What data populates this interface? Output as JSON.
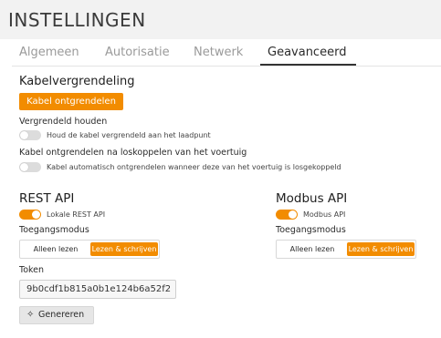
{
  "header": {
    "title": "INSTELLINGEN"
  },
  "tabs": [
    {
      "label": "Algemeen"
    },
    {
      "label": "Autorisatie"
    },
    {
      "label": "Netwerk"
    },
    {
      "label": "Geavanceerd"
    }
  ],
  "active_tab": "Geavanceerd",
  "cable_lock": {
    "title": "Kabelvergrendeling",
    "unlock_button": "Kabel ontgrendelen",
    "keep_locked": {
      "label": "Vergrendeld houden",
      "hint": "Houd de kabel vergrendeld aan het laadpunt",
      "enabled": false
    },
    "auto_unlock": {
      "label": "Kabel ontgrendelen na loskoppelen van het voertuig",
      "hint": "Kabel automatisch ontgrendelen wanneer deze van het voertuig is losgekoppeld",
      "enabled": false
    }
  },
  "rest_api": {
    "title": "REST API",
    "toggle_label": "Lokale REST API",
    "enabled": true,
    "access_label": "Toegangsmodus",
    "access_options": [
      "Alleen lezen",
      "Lezen & schrijven"
    ],
    "access_selected": "Lezen & schrijven",
    "token_label": "Token",
    "token_value": "9b0cdf1b815a0b1e124b6a52f2",
    "generate_button": "Genereren",
    "generate_icon": "sparkle-icon"
  },
  "modbus_api": {
    "title": "Modbus API",
    "toggle_label": "Modbus API",
    "enabled": true,
    "access_label": "Toegangsmodus",
    "access_options": [
      "Alleen lezen",
      "Lezen & schrijven"
    ],
    "access_selected": "Lezen & schrijven"
  },
  "colors": {
    "accent": "#f28c00",
    "header_bg": "#f2f2f2"
  }
}
